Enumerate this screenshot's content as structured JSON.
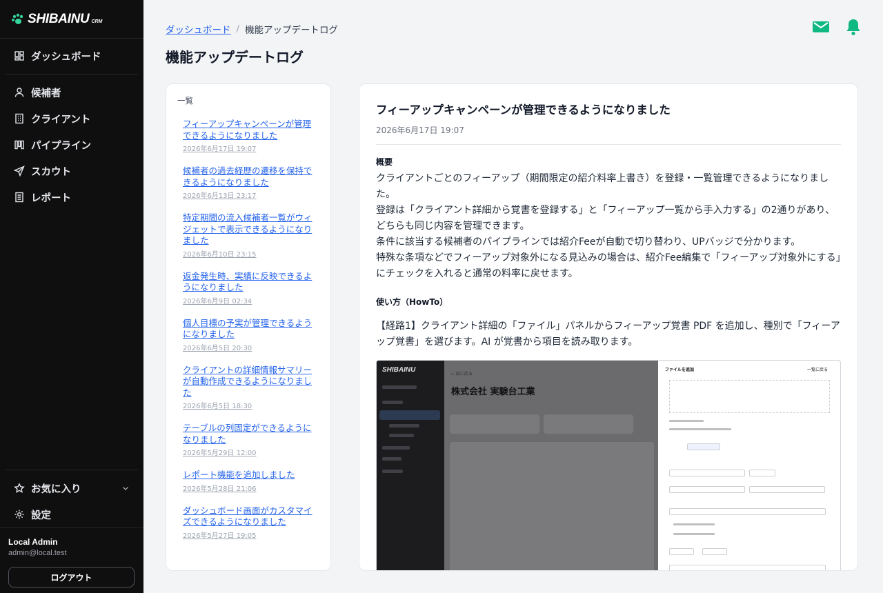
{
  "app": {
    "logo": "SHIBAINU",
    "logo_sub": "CRM"
  },
  "sidebar": {
    "dashboard": "ダッシュボード",
    "items": [
      {
        "label": "候補者",
        "icon": "person-icon"
      },
      {
        "label": "クライアント",
        "icon": "building-icon"
      },
      {
        "label": "パイプライン",
        "icon": "pipeline-icon"
      },
      {
        "label": "スカウト",
        "icon": "send-icon"
      },
      {
        "label": "レポート",
        "icon": "report-icon"
      }
    ],
    "favorites": "お気に入り",
    "settings": "設定"
  },
  "user": {
    "name": "Local Admin",
    "email": "admin@local.test",
    "logout": "ログアウト"
  },
  "breadcrumb": {
    "parent": "ダッシュボード",
    "separator": "/",
    "current": "機能アップデートログ"
  },
  "page_title": "機能アップデートログ",
  "list": {
    "heading": "一覧",
    "entries": [
      {
        "title": "フィーアップキャンペーンが管理できるようになりました",
        "date": "2026年6月17日 19:07"
      },
      {
        "title": "候補者の過去経歴の遷移を保持できるようになりました",
        "date": "2026年6月13日 23:17"
      },
      {
        "title": "特定期間の流入候補者一覧がウィジェットで表示できるようになりました",
        "date": "2026年6月10日 23:15"
      },
      {
        "title": "返金発生時、実績に反映できるようになりました",
        "date": "2026年6月9日 02:34"
      },
      {
        "title": "個人目標の予実が管理できるようになりました",
        "date": "2026年6月5日 20:30"
      },
      {
        "title": "クライアントの詳細情報サマリーが自動作成できるようになりました",
        "date": "2026年6月5日 18:30"
      },
      {
        "title": "テーブルの列固定ができるようになりました",
        "date": "2026年5月29日 12:00"
      },
      {
        "title": "レポート機能を追加しました",
        "date": "2026年5月28日 21:06"
      },
      {
        "title": "ダッシュボード画面がカスタマイズできるようになりました",
        "date": "2026年5月27日 19:05"
      }
    ]
  },
  "detail": {
    "title": "フィーアップキャンペーンが管理できるようになりました",
    "date": "2026年6月17日 19:07",
    "summary_heading": "概要",
    "summary_lines": [
      "クライアントごとのフィーアップ（期間限定の紹介料率上書き）を登録・一覧管理できるようになりました。",
      "登録は「クライアント詳細から覚書を登録する」と「フィーアップ一覧から手入力する」の2通りがあり、どちらも同じ内容を管理できます。",
      "条件に該当する候補者のパイプラインでは紹介Feeが自動で切り替わり、UPバッジで分かります。",
      "特殊な条項などでフィーアップ対象外になる見込みの場合は、紹介Fee編集で「フィーアップ対象外にする」にチェックを入れると通常の料率に戻せます。"
    ],
    "howto_heading": "使い方（HowTo）",
    "step1": "【経路1】クライアント詳細の「ファイル」パネルからフィーアップ覚書 PDF を追加し、種別で「フィーアップ覚書」を選びます。AI が覚書から項目を読み取ります。",
    "screenshot": {
      "logo": "SHIBAINU",
      "back": "← 前に戻る",
      "company": "株式会社 実験台工業",
      "drawer_title": "ファイルを追加",
      "drawer_close": "一覧に戻る"
    }
  }
}
